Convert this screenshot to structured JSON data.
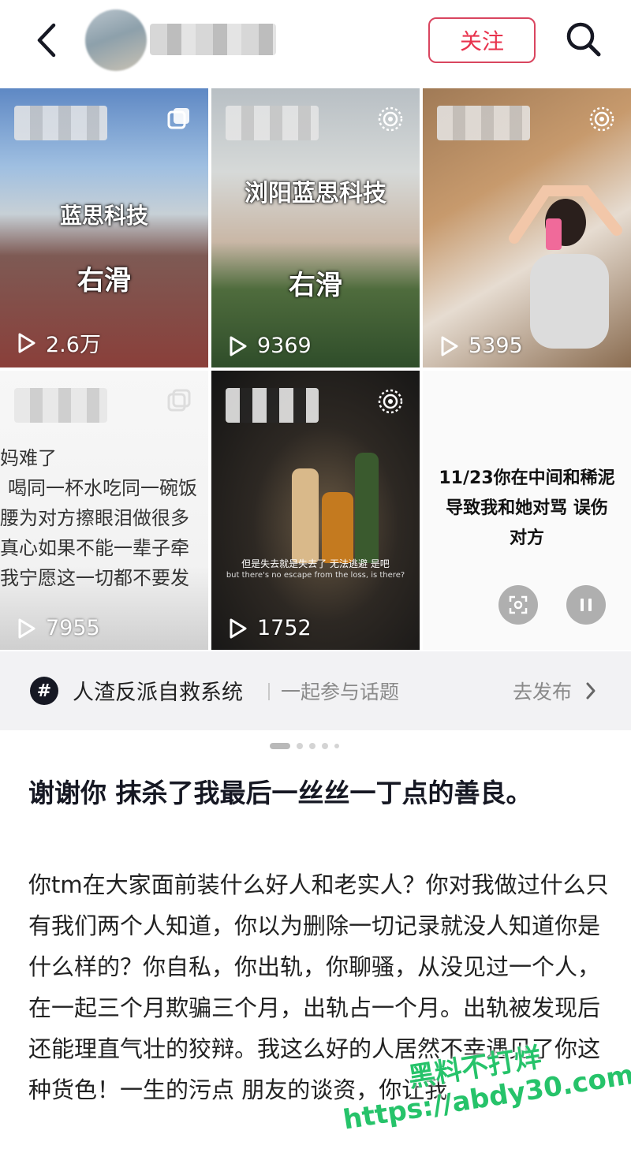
{
  "header": {
    "follow_label": "关注",
    "back_icon": "chevron-left-icon",
    "search_icon": "search-icon"
  },
  "grid": {
    "tiles": [
      {
        "brand": "蓝思科技",
        "swipe": "右滑",
        "plays": "2.6万"
      },
      {
        "brand": "浏阳蓝思科技",
        "swipe": "右滑",
        "plays": "9369"
      },
      {
        "plays": "5395"
      },
      {
        "lines": [
          "妈难了",
          "喝同一杯水吃同一碗饭",
          "腰为对方擦眼泪做很多",
          "真心如果不能一辈子牵",
          "我宁愿这一切都不要发"
        ],
        "plays": "7955"
      },
      {
        "caption_zh": "但是失去就是失去了 无法逃避 是吧",
        "caption_en": "but there's no escape from the loss, is there?",
        "plays": "1752"
      },
      {
        "text_lines": [
          "11/23你在中间和稀泥",
          "导致我和她对骂 误伤",
          "对方"
        ]
      }
    ]
  },
  "topic": {
    "name": "人渣反派自救系统",
    "join": "一起参与话题",
    "post": "去发布"
  },
  "post": {
    "title": "谢谢你 抹杀了我最后一丝丝一丁点的善良。",
    "body": "你tm在大家面前装什么好人和老实人？你对我做过什么只有我们两个人知道，你以为删除一切记录就没人知道你是什么样的？你自私，你出轨，你聊骚，从没见过一个人，在一起三个月欺骗三个月，出轨占一个月。出轨被发现后还能理直气壮的狡辩。我这么好的人居然不幸遇见了你这种货色！一生的污点 朋友的谈资，你让我"
  },
  "watermark": {
    "line1": "黑料不打烊",
    "line2": "https://abdy30.com"
  },
  "colors": {
    "accent": "#e8344e",
    "watermark": "#26c36a"
  }
}
